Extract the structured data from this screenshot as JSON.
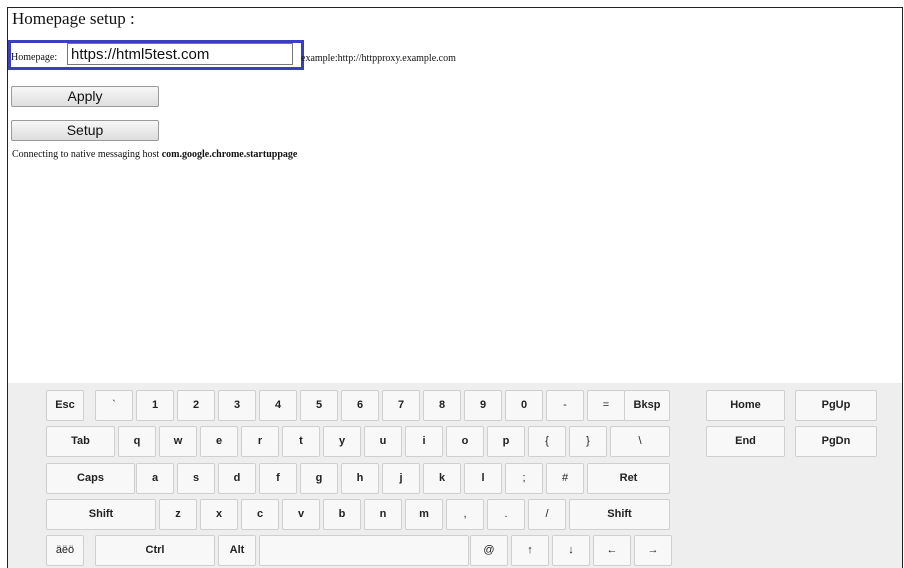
{
  "setup": {
    "title": "Homepage setup :",
    "homepage_label": "Homepage:",
    "homepage_value": "https://html5test.com",
    "example_text": "example:http://httpproxy.example.com",
    "apply_label": "Apply",
    "setup_label": "Setup",
    "status_prefix": "Connecting to native messaging host ",
    "status_host": "com.google.chrome.startuppage"
  },
  "keyboard": {
    "row1": [
      "Esc",
      "`",
      "1",
      "2",
      "3",
      "4",
      "5",
      "6",
      "7",
      "8",
      "9",
      "0",
      "-",
      "=",
      "Bksp"
    ],
    "row2": [
      "Tab",
      "q",
      "w",
      "e",
      "r",
      "t",
      "y",
      "u",
      "i",
      "o",
      "p",
      "{",
      "}",
      "\\"
    ],
    "row3": [
      "Caps",
      "a",
      "s",
      "d",
      "f",
      "g",
      "h",
      "j",
      "k",
      "l",
      ";",
      "#",
      "Ret"
    ],
    "row4": [
      "Shift",
      "z",
      "x",
      "c",
      "v",
      "b",
      "n",
      "m",
      ",",
      ".",
      "/",
      "Shift"
    ],
    "row5": [
      "äëö",
      "Ctrl",
      "Alt",
      "",
      "@",
      "↑",
      "↓",
      "←",
      "→"
    ],
    "nav": [
      "Home",
      "PgUp",
      "End",
      "PgDn"
    ]
  }
}
